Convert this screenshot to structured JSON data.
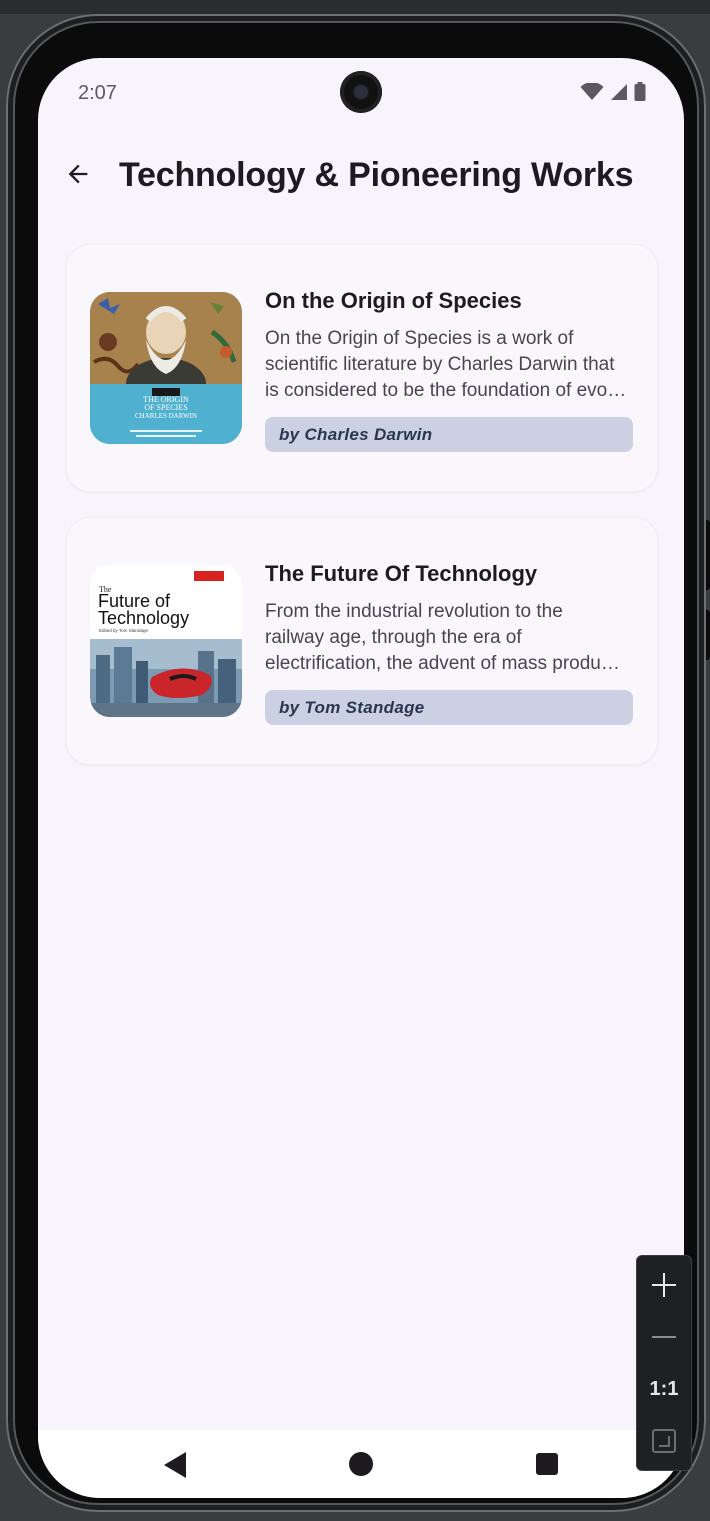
{
  "status_bar": {
    "time": "2:07",
    "icons": [
      "wifi-icon",
      "signal-icon",
      "battery-icon"
    ]
  },
  "top_app_bar": {
    "back_icon": "arrow-back-icon",
    "title": "Technology & Pioneering Works"
  },
  "books": [
    {
      "title": "On the Origin of Species",
      "description_lines": [
        "On the Origin of Species is a work of",
        "scientific literature by Charles Darwin that",
        "is considered to be the foundation of evo…"
      ],
      "author": "by Charles Darwin",
      "cover": {
        "icon": "book-cover-origin-of-species",
        "title_lines": [
          "THE ORIGIN",
          "OF SPECIES"
        ],
        "author": "CHARLES DARWIN"
      }
    },
    {
      "title": "The Future Of Technology",
      "description_lines": [
        "From the industrial revolution to the",
        "railway age, through the era of",
        "electrification, the advent of mass produ…"
      ],
      "author": "by Tom Standage",
      "cover": {
        "icon": "book-cover-future-of-technology",
        "small": "The",
        "title_lines": [
          "Future of",
          "Technology"
        ],
        "edited": "Edited by Tom Standage"
      }
    }
  ],
  "nav_bar": {
    "icons": [
      "nav-back-icon",
      "nav-home-icon",
      "nav-recents-icon"
    ]
  },
  "zoom_controls": {
    "reset_label": "1:1",
    "icons": [
      "zoom-in-icon",
      "zoom-out-icon",
      "fit-screen-icon"
    ]
  },
  "colors": {
    "background": "#f8f4fc",
    "card": "#faf7fc",
    "author_chip": "#cbd1e2",
    "author_text": "#2c3650",
    "title_text": "#1d1b20"
  }
}
